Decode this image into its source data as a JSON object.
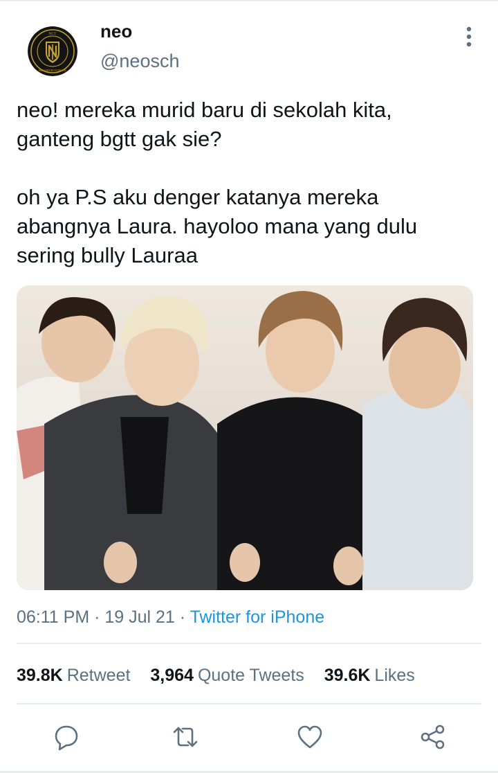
{
  "tweet": {
    "display_name": "neo",
    "handle": "@neosch",
    "text": "neo! mereka murid baru di sekolah kita,\nganteng bgtt gak sie?\n\noh ya P.S aku denger katanya mereka\nabangnya Laura. hayoloo mana yang dulu\nsering bully Lauraa",
    "time": "06:11 PM",
    "date": "19 Jul 21",
    "separator": " · ",
    "source": "Twitter for iPhone",
    "stats": {
      "retweets_count": "39.8K",
      "retweets_label": "Retweet",
      "quotes_count": "3,964",
      "quotes_label": "Quote Tweets",
      "likes_count": "39.6K",
      "likes_label": "Likes"
    },
    "avatar_badge_text": "NEO HIGH SCHOOL",
    "avatar_monogram": "NT"
  },
  "icons": {
    "more": "more-vertical-icon",
    "reply": "reply-icon",
    "retweet": "retweet-icon",
    "like": "heart-icon",
    "share": "share-icon"
  },
  "colors": {
    "text": "#0f1419",
    "secondary": "#5b7083",
    "link": "#1b95e0",
    "divider": "#e6ecf0",
    "avatar_bg": "#141414",
    "avatar_gold": "#c9a434"
  }
}
